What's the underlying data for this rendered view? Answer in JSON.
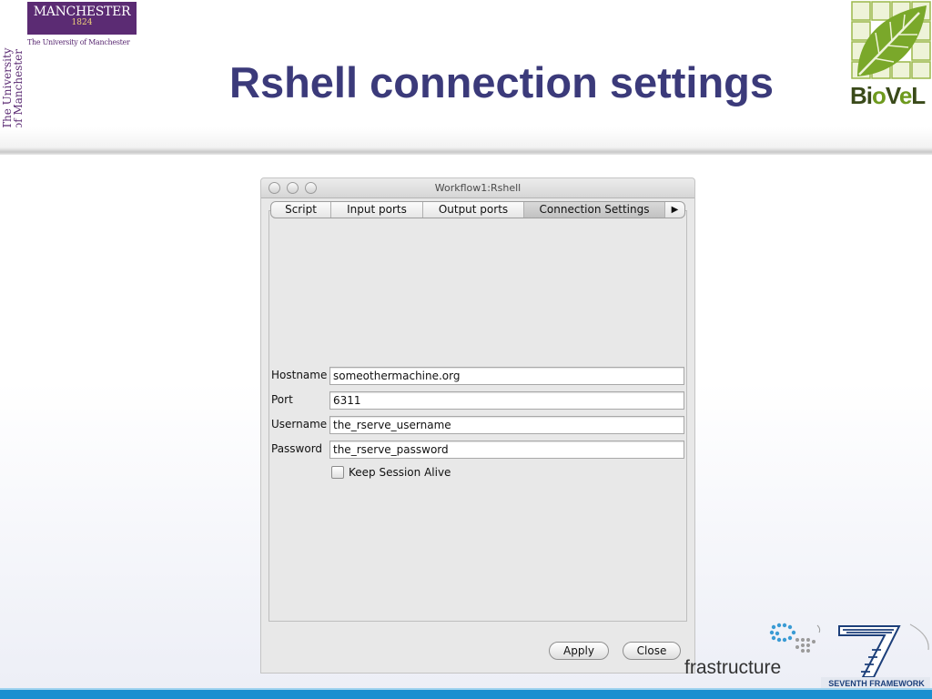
{
  "slide": {
    "title": "Rshell connection settings"
  },
  "logos": {
    "manchester": {
      "name": "MANCHESTER",
      "year": "1824",
      "subtitle": "The University of Manchester",
      "vertical_line1": "The University",
      "vertical_line2": "of Manchester",
      "color": "#5b2b73"
    },
    "biovel": {
      "text_part1": "Bi",
      "text_part2": "o",
      "text_part3": "V",
      "text_part4": "e",
      "text_part5": "L",
      "icon": "leaf-grid-icon"
    },
    "einfrastructure": {
      "text": "frastructure",
      "icon": "dot-cluster-icon"
    },
    "fp7": {
      "text": "SEVENTH FRAMEWORK",
      "icon": "seven-stripes-icon"
    }
  },
  "window": {
    "title": "Workflow1:Rshell",
    "tabs": [
      {
        "label": "Script",
        "selected": false
      },
      {
        "label": "Input ports",
        "selected": false
      },
      {
        "label": "Output ports",
        "selected": false
      },
      {
        "label": "Connection Settings",
        "selected": true
      }
    ],
    "tab_overflow_icon": "arrow-right-icon",
    "fields": {
      "hostname": {
        "label": "Hostname",
        "value": "someothermachine.org"
      },
      "port": {
        "label": "Port",
        "value": "6311"
      },
      "username": {
        "label": "Username",
        "value": "the_rserve_username"
      },
      "password": {
        "label": "Password",
        "value": "the_rserve_password"
      }
    },
    "keep_alive": {
      "label": "Keep Session Alive",
      "checked": false
    },
    "buttons": {
      "apply": "Apply",
      "close": "Close"
    }
  },
  "colors": {
    "title": "#3b3a7a",
    "bottom_bar": "#1a8fd0",
    "biovel_green": "#6e9a1e"
  }
}
